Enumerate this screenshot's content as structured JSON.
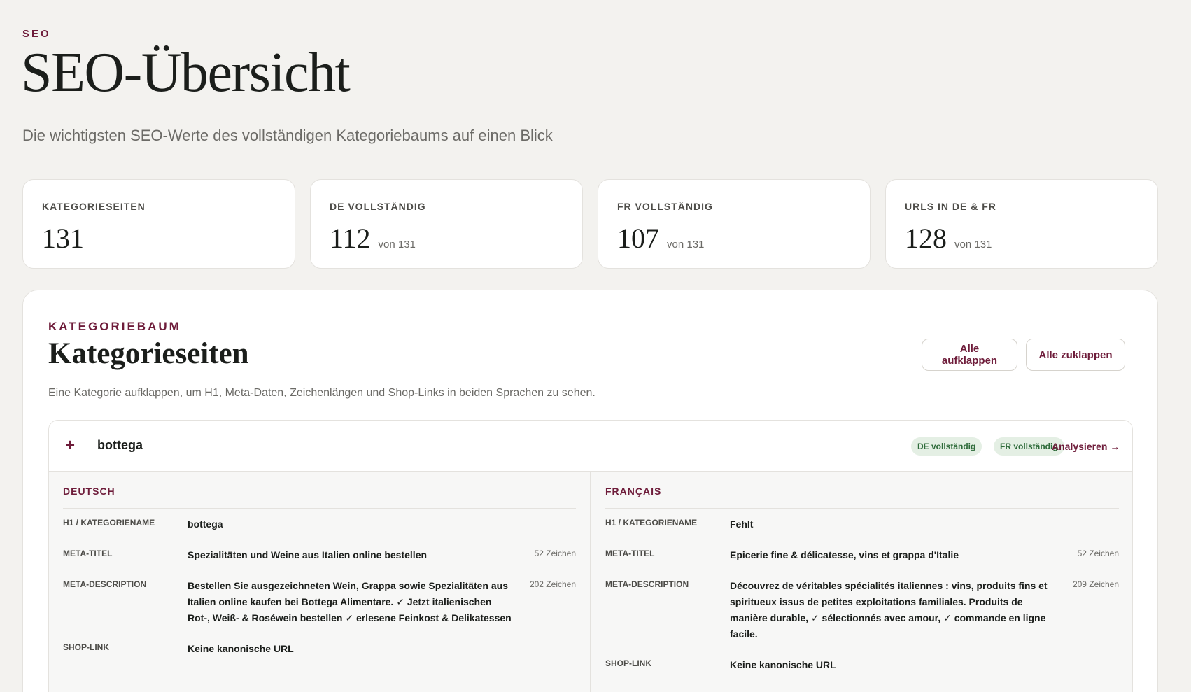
{
  "header": {
    "eyebrow": "SEO",
    "title": "SEO-Übersicht",
    "subtitle": "Die wichtigsten SEO-Werte des vollständigen Kategoriebaums auf einen Blick"
  },
  "stats": [
    {
      "label": "KATEGORIESEITEN",
      "value": "131",
      "of": ""
    },
    {
      "label": "DE VOLLSTÄNDIG",
      "value": "112",
      "of": "von 131"
    },
    {
      "label": "FR VOLLSTÄNDIG",
      "value": "107",
      "of": "von 131"
    },
    {
      "label": "URLS IN DE & FR",
      "value": "128",
      "of": "von 131"
    }
  ],
  "tree": {
    "eyebrow": "KATEGORIEBAUM",
    "title": "Kategorieseiten",
    "description": "Eine Kategorie aufklappen, um H1, Meta-Daten, Zeichenlängen und Shop-Links in beiden Sprachen zu sehen.",
    "expand_all": "Alle aufklappen",
    "collapse_all": "Alle zuklappen",
    "category": {
      "expander": "+",
      "name": "bottega",
      "badge_de": "DE vollständig",
      "badge_fr": "FR vollständig",
      "analyse": "Analysieren →",
      "de": {
        "heading": "DEUTSCH",
        "h1_label": "H1 / KATEGORIENAME",
        "h1": "bottega",
        "meta_title_label": "META-TITEL",
        "meta_title": "Spezialitäten und Weine aus Italien online bestellen",
        "meta_title_count": "52 Zeichen",
        "meta_desc_label": "META-DESCRIPTION",
        "meta_desc": "Bestellen Sie ausgezeichneten Wein, Grappa sowie Spezialitäten aus Italien online kaufen bei Bottega Alimentare. ✓ Jetzt italienischen Rot-, Weiß- & Roséwein bestellen ✓ erlesene Feinkost & Delikatessen",
        "meta_desc_count": "202 Zeichen",
        "shop_label": "SHOP-LINK",
        "shop": "Keine kanonische URL"
      },
      "fr": {
        "heading": "FRANÇAIS",
        "h1_label": "H1 / KATEGORIENAME",
        "h1": "Fehlt",
        "meta_title_label": "META-TITEL",
        "meta_title": "Epicerie fine & délicatesse, vins et grappa d'Italie",
        "meta_title_count": "52 Zeichen",
        "meta_desc_label": "META-DESCRIPTION",
        "meta_desc": "Découvrez de véritables spécialités italiennes : vins, produits fins et spiritueux issus de petites exploitations familiales. Produits de manière durable, ✓ sélectionnés avec amour, ✓ commande en ligne facile.",
        "meta_desc_count": "209 Zeichen",
        "shop_label": "SHOP-LINK",
        "shop": "Keine kanonische URL"
      }
    }
  },
  "colors": {
    "accent": "#6e1c3a",
    "background": "#f3f2ef",
    "badge_bg": "#e4efe4",
    "badge_text": "#2e6b3a"
  }
}
